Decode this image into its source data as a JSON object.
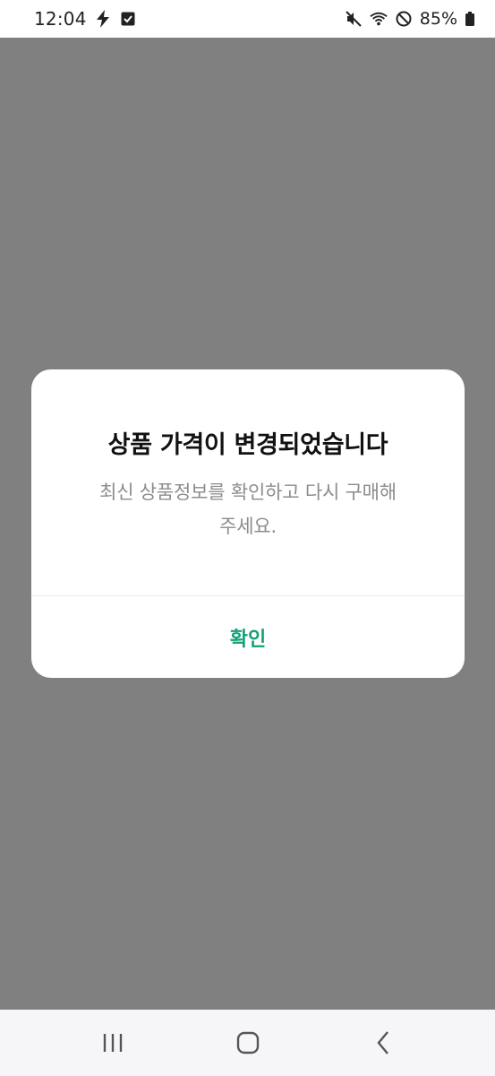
{
  "status_bar": {
    "time": "12:04",
    "battery_percent": "85%",
    "icons": [
      "flash-icon",
      "checkbox-notification-icon",
      "mute-icon",
      "wifi-icon",
      "do-not-disturb-icon",
      "battery-icon"
    ]
  },
  "dialog": {
    "title": "상품 가격이 변경되었습니다",
    "message_line1": "최신 상품정보를 확인하고 다시 구매해",
    "message_line2": "주세요.",
    "confirm_label": "확인",
    "confirm_color": "#13a077"
  },
  "nav_bar": {
    "icons": [
      "recent-apps-icon",
      "home-icon",
      "back-icon"
    ]
  },
  "colors": {
    "overlay": "#808080",
    "dialog_bg": "#ffffff",
    "title_text": "#111111",
    "message_text": "#8c8c8c"
  }
}
